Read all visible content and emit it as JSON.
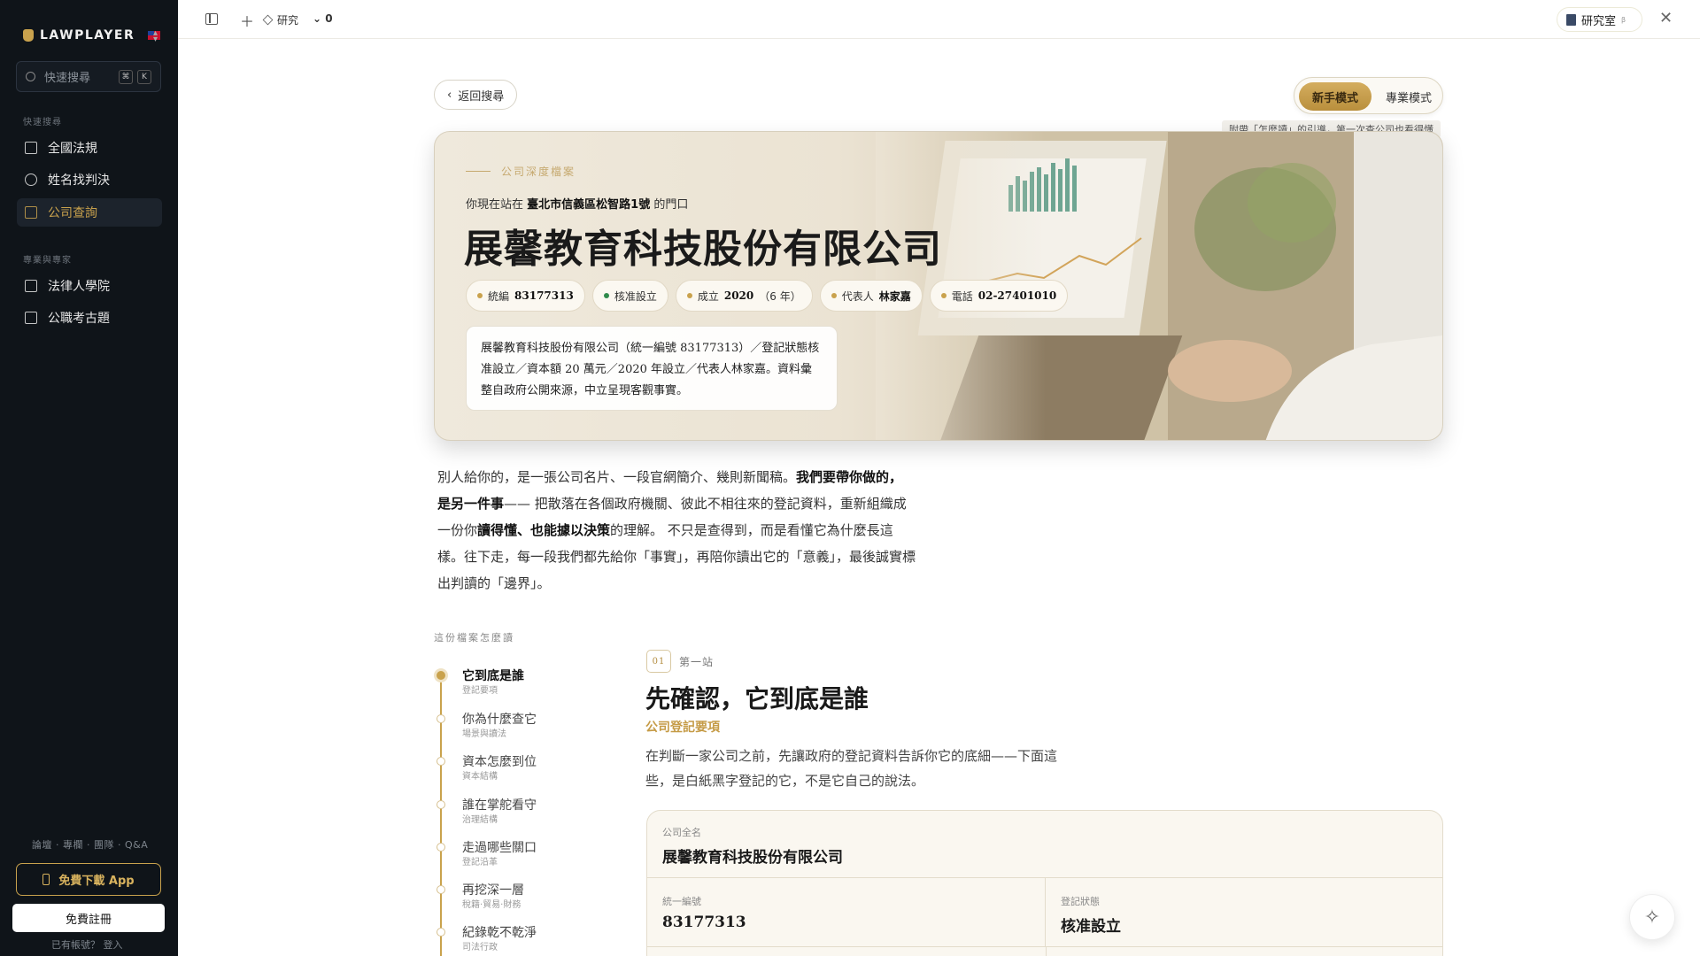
{
  "sidebar": {
    "brand": "LAWPLAYER",
    "search_placeholder": "快速搜尋",
    "shortcut_keys": [
      "⌘",
      "K"
    ],
    "section_quick": "快速搜尋",
    "quick_items": [
      {
        "label": "全國法規",
        "icon": "law-book-icon"
      },
      {
        "label": "姓名找判決",
        "icon": "search-icon"
      },
      {
        "label": "公司查詢",
        "icon": "building-icon",
        "active": true
      }
    ],
    "section_pro": "專業與專家",
    "pro_items": [
      {
        "label": "法律人學院",
        "icon": "library-icon"
      },
      {
        "label": "公職考古題",
        "icon": "chart-icon"
      }
    ],
    "footer_links": "論壇 · 專欄 · 團隊 · Q&A",
    "app_button": "免費下載 App",
    "register_button": "免費註冊",
    "login_hint": "已有帳號？ 登入"
  },
  "topbar": {
    "project": "研究",
    "count": "0",
    "lab_label": "研究室",
    "lab_badge": "β"
  },
  "main": {
    "back_button": "返回搜尋",
    "mode_beginner": "新手模式",
    "mode_pro": "專業模式",
    "mode_tip": "附帶「怎麼讀」的引導，第一次查公司也看得懂",
    "hero": {
      "kicker": "公司深度檔案",
      "location_prefix": "你現在站在",
      "location": "臺北市信義區松智路1號",
      "location_suffix": "的門口",
      "company_name": "展馨教育科技股份有限公司",
      "chips": [
        {
          "label": "統編",
          "value": "83177313"
        },
        {
          "label": "",
          "value": "核准設立"
        },
        {
          "label": "成立",
          "value": "2020",
          "extra": "（6 年）"
        },
        {
          "label": "代表人",
          "value": "林家嘉"
        },
        {
          "label": "電話",
          "value": "02-27401010"
        }
      ],
      "summary": "展馨教育科技股份有限公司（統一編號 83177313）／登記狀態核准設立／資本額 20 萬元／2020 年設立／代表人林家嘉。資料彙整自政府公開來源，中立呈現客觀事實。"
    },
    "intro": {
      "p1": "別人給你的，是一張公司名片、一段官網簡介、幾則新聞稿。",
      "b1": "我們要帶你做的，是另一件事",
      "p2": "—— 把散落在各個政府機關、彼此不相往來的登記資料，重新組織成一份你",
      "b2": "讀得懂、也能據以決策",
      "p3": "的理解。 不只是查得到，而是看懂它為什麼長這樣。往下走，每一段我們都先給你「事實」，再陪你讀出它的「意義」，最後誠實標出判讀的「邊界」。"
    },
    "toc_title": "這份檔案怎麼讀",
    "toc": [
      {
        "title": "它到底是誰",
        "sub": "登記要項"
      },
      {
        "title": "你為什麼查它",
        "sub": "場景與讀法"
      },
      {
        "title": "資本怎麼到位",
        "sub": "資本結構"
      },
      {
        "title": "誰在掌舵看守",
        "sub": "治理結構"
      },
      {
        "title": "走過哪些關口",
        "sub": "登記沿革"
      },
      {
        "title": "再挖深一層",
        "sub": "稅籍·貿易·財務"
      },
      {
        "title": "紀錄乾不乾淨",
        "sub": "司法行政"
      }
    ],
    "stop": {
      "number": "01",
      "label": "第一站",
      "title": "先確認，它到底是誰",
      "subtitle": "公司登記要項",
      "description": "在判斷一家公司之前，先讓政府的登記資料告訴你它的底細——下面這些，是白紙黑字登記的它，不是它自己的說法。"
    },
    "card": {
      "full_name_label": "公司全名",
      "full_name": "展馨教育科技股份有限公司",
      "tax_id_label": "統一編號",
      "tax_id": "83177313",
      "status_label": "登記狀態",
      "status": "核准設立"
    }
  }
}
